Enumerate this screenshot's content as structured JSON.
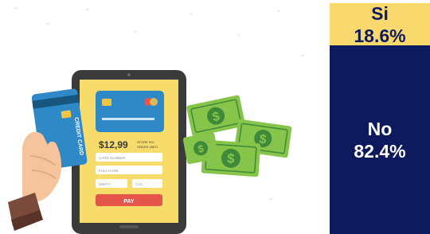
{
  "chart_data": {
    "type": "bar",
    "stacked": true,
    "categories": [
      "Si",
      "No"
    ],
    "values": [
      18.6,
      82.4
    ],
    "labels": [
      "18.6%",
      "82.4%"
    ],
    "unit": "%",
    "colors": [
      "#f9d86d",
      "#0d1b5e"
    ],
    "label_colors": [
      "#0d1b5e",
      "#ffffff"
    ]
  },
  "illustration": {
    "card_brand_text": "CREDIT CARD",
    "price": "$12,99",
    "store_text": "STORE INC",
    "order_text": "ORDER 45871",
    "card_number_placeholder": "CARD NUMBER",
    "full_name_placeholder": "FULL NAME",
    "expiry_placeholder": "MM/YY",
    "cvc_placeholder": "CVC",
    "pay_label": "PAY",
    "money_symbol": "$",
    "colors": {
      "tablet": "#3a3a3a",
      "screen": "#f8dc6b",
      "card_blue": "#2f89c6",
      "card_dark": "#17577f",
      "pay": "#e4554a",
      "money": "#86c44a",
      "money_dark": "#3f8a3a",
      "skin": "#f5c49c",
      "sleeve": "#7a4a3a"
    }
  }
}
